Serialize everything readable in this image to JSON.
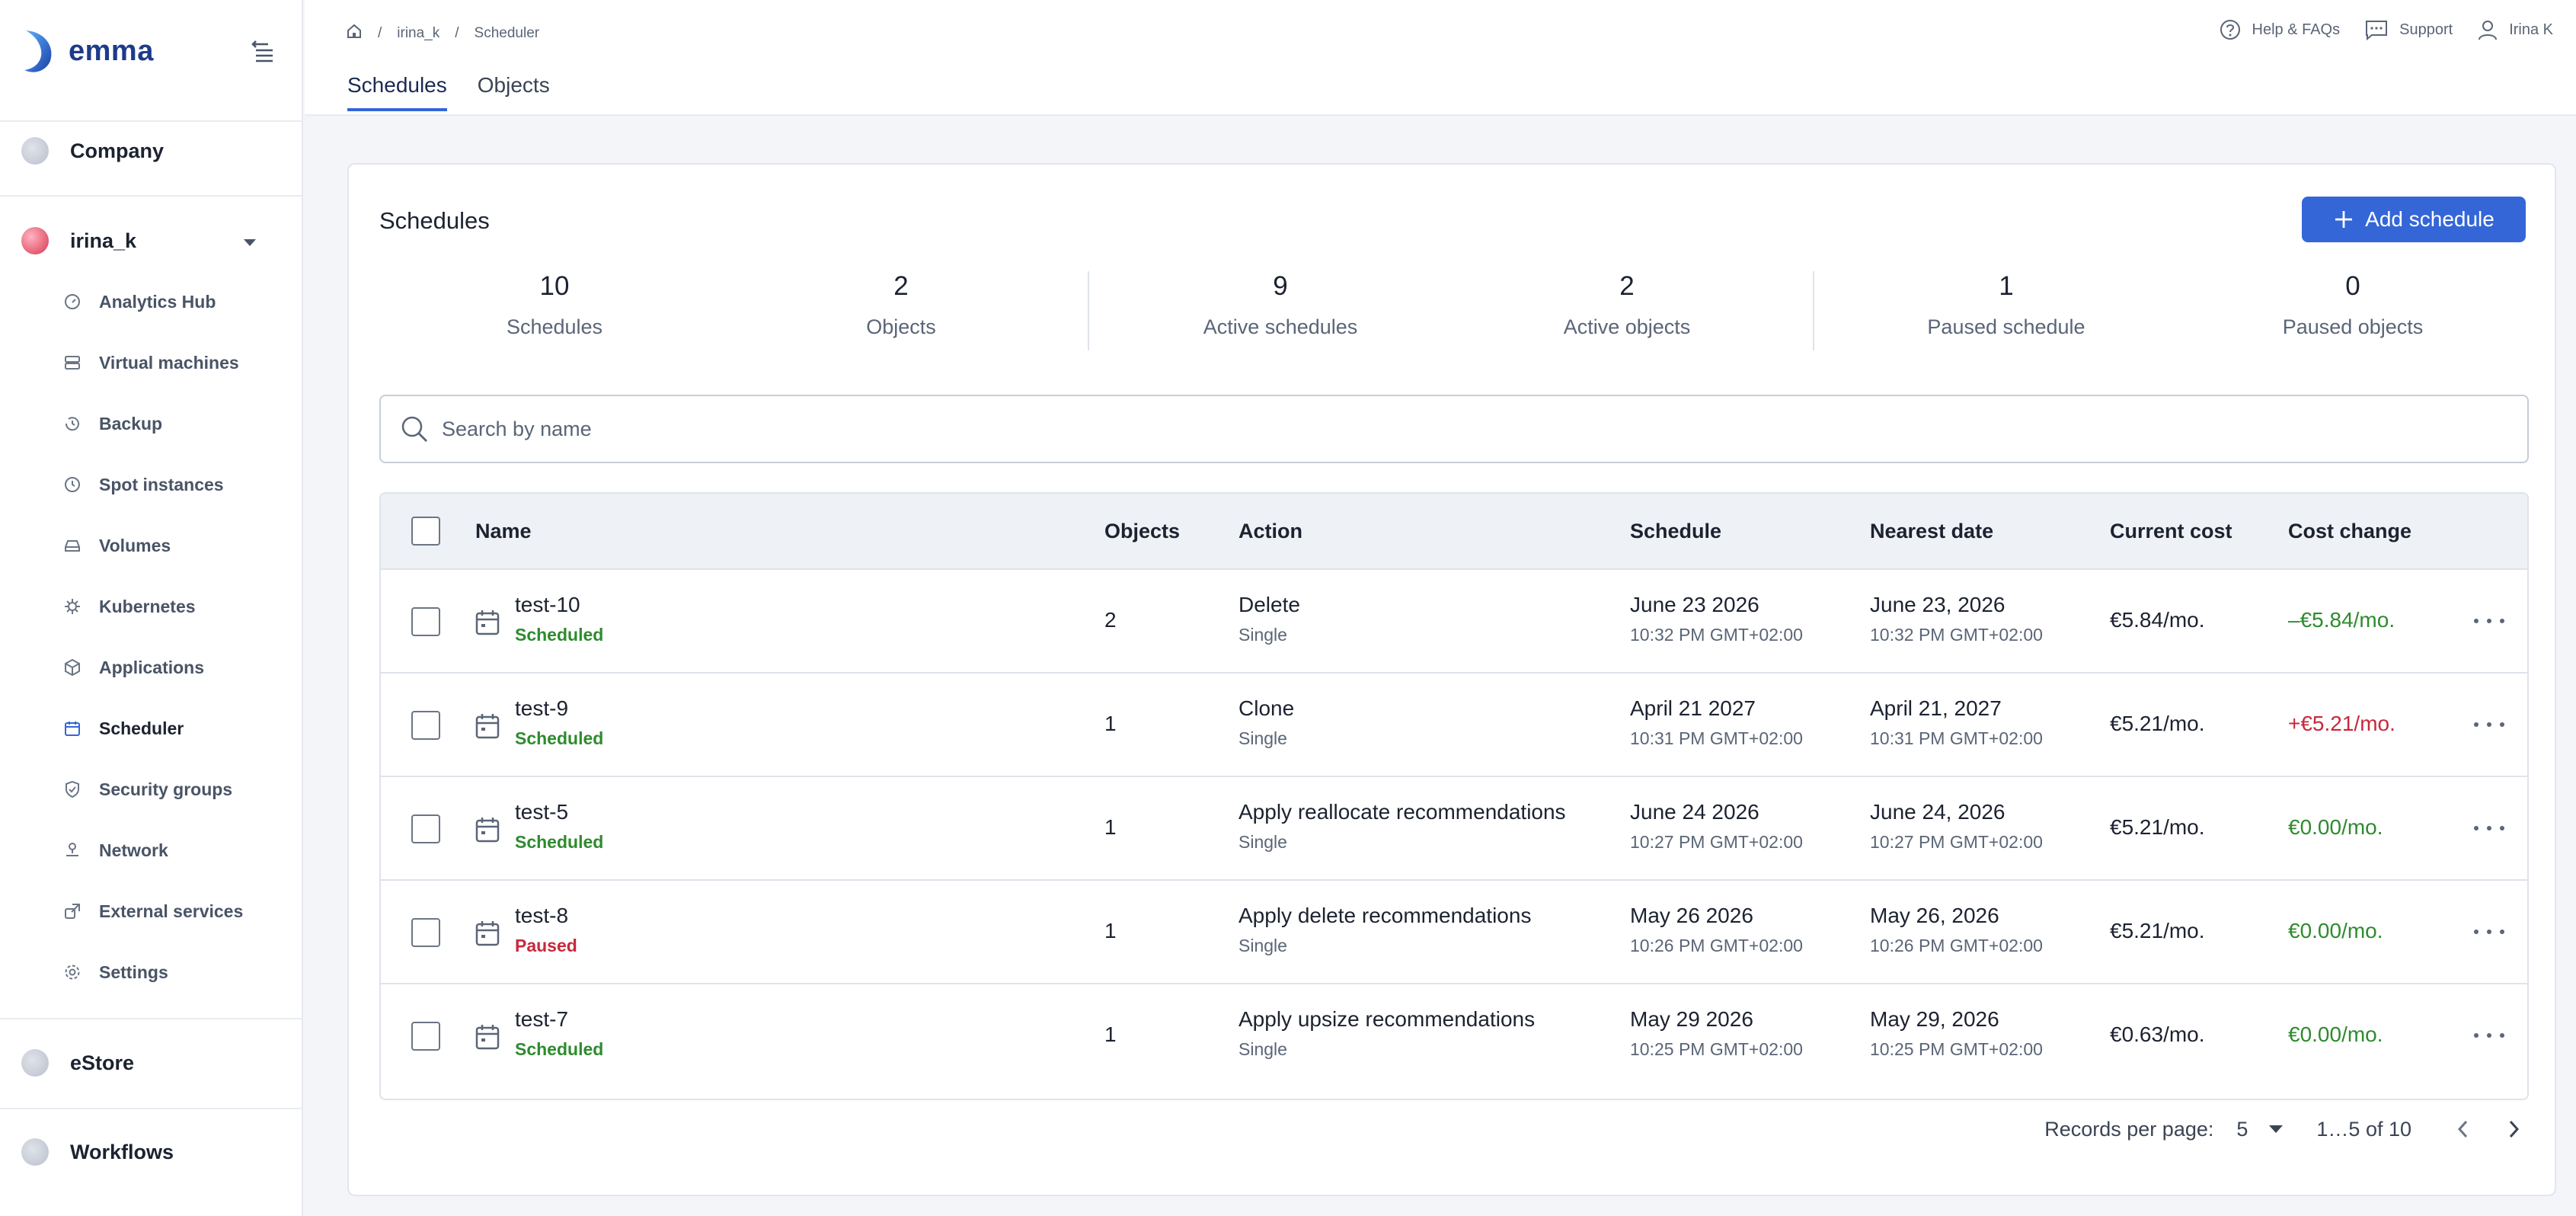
{
  "brand": {
    "name": "emma"
  },
  "sidebar": {
    "orgs": [
      {
        "label": "Company"
      },
      {
        "label": "irina_k"
      },
      {
        "label": "eStore"
      },
      {
        "label": "Workflows"
      }
    ],
    "items": [
      {
        "label": "Analytics Hub",
        "icon": "gauge-icon"
      },
      {
        "label": "Virtual machines",
        "icon": "server-icon"
      },
      {
        "label": "Backup",
        "icon": "history-icon"
      },
      {
        "label": "Spot instances",
        "icon": "clock-icon"
      },
      {
        "label": "Volumes",
        "icon": "drive-icon"
      },
      {
        "label": "Kubernetes",
        "icon": "helm-icon"
      },
      {
        "label": "Applications",
        "icon": "cube-icon"
      },
      {
        "label": "Scheduler",
        "icon": "calendar-icon"
      },
      {
        "label": "Security groups",
        "icon": "shield-icon"
      },
      {
        "label": "Network",
        "icon": "network-icon"
      },
      {
        "label": "External services",
        "icon": "external-icon"
      },
      {
        "label": "Settings",
        "icon": "gear-icon"
      }
    ]
  },
  "breadcrumb": {
    "items": [
      "irina_k",
      "Scheduler"
    ]
  },
  "top_links": {
    "help": "Help & FAQs",
    "support": "Support",
    "user": "Irina K"
  },
  "tabs": [
    {
      "label": "Schedules"
    },
    {
      "label": "Objects"
    }
  ],
  "card": {
    "title": "Schedules",
    "add_button": "Add schedule",
    "stats": [
      {
        "value": "10",
        "label": "Schedules"
      },
      {
        "value": "2",
        "label": "Objects"
      },
      {
        "value": "9",
        "label": "Active schedules"
      },
      {
        "value": "2",
        "label": "Active objects"
      },
      {
        "value": "1",
        "label": "Paused schedule"
      },
      {
        "value": "0",
        "label": "Paused objects"
      }
    ],
    "search_placeholder": "Search by name"
  },
  "table": {
    "columns": [
      "Name",
      "Objects",
      "Action",
      "Schedule",
      "Nearest date",
      "Current cost",
      "Cost change"
    ],
    "rows": [
      {
        "name": "test-10",
        "status": "Scheduled",
        "objects": "2",
        "action": "Delete",
        "action_type": "Single",
        "schedule_date": "June 23 2026",
        "schedule_time": "10:32 PM GMT+02:00",
        "nearest_date": "June 23, 2026",
        "nearest_time": "10:32 PM GMT+02:00",
        "current_cost": "€5.84/mo.",
        "cost_change": "–€5.84/mo."
      },
      {
        "name": "test-9",
        "status": "Scheduled",
        "objects": "1",
        "action": "Clone",
        "action_type": "Single",
        "schedule_date": "April 21 2027",
        "schedule_time": "10:31 PM GMT+02:00",
        "nearest_date": "April 21, 2027",
        "nearest_time": "10:31 PM GMT+02:00",
        "current_cost": "€5.21/mo.",
        "cost_change": "+€5.21/mo."
      },
      {
        "name": "test-5",
        "status": "Scheduled",
        "objects": "1",
        "action": "Apply reallocate recommendations",
        "action_type": "Single",
        "schedule_date": "June 24 2026",
        "schedule_time": "10:27 PM GMT+02:00",
        "nearest_date": "June 24, 2026",
        "nearest_time": "10:27 PM GMT+02:00",
        "current_cost": "€5.21/mo.",
        "cost_change": "€0.00/mo."
      },
      {
        "name": "test-8",
        "status": "Paused",
        "objects": "1",
        "action": "Apply delete recommendations",
        "action_type": "Single",
        "schedule_date": "May 26 2026",
        "schedule_time": "10:26 PM GMT+02:00",
        "nearest_date": "May 26, 2026",
        "nearest_time": "10:26 PM GMT+02:00",
        "current_cost": "€5.21/mo.",
        "cost_change": "€0.00/mo."
      },
      {
        "name": "test-7",
        "status": "Scheduled",
        "objects": "1",
        "action": "Apply upsize recommendations",
        "action_type": "Single",
        "schedule_date": "May 29 2026",
        "schedule_time": "10:25 PM GMT+02:00",
        "nearest_date": "May 29, 2026",
        "nearest_time": "10:25 PM GMT+02:00",
        "current_cost": "€0.63/mo.",
        "cost_change": "€0.00/mo."
      }
    ]
  },
  "pagination": {
    "records_label": "Records per page:",
    "per_page": "5",
    "range": "1…5 of 10"
  },
  "colors": {
    "accent": "#3466d8",
    "positive": "#2e8b2e",
    "negative": "#c8283c"
  }
}
